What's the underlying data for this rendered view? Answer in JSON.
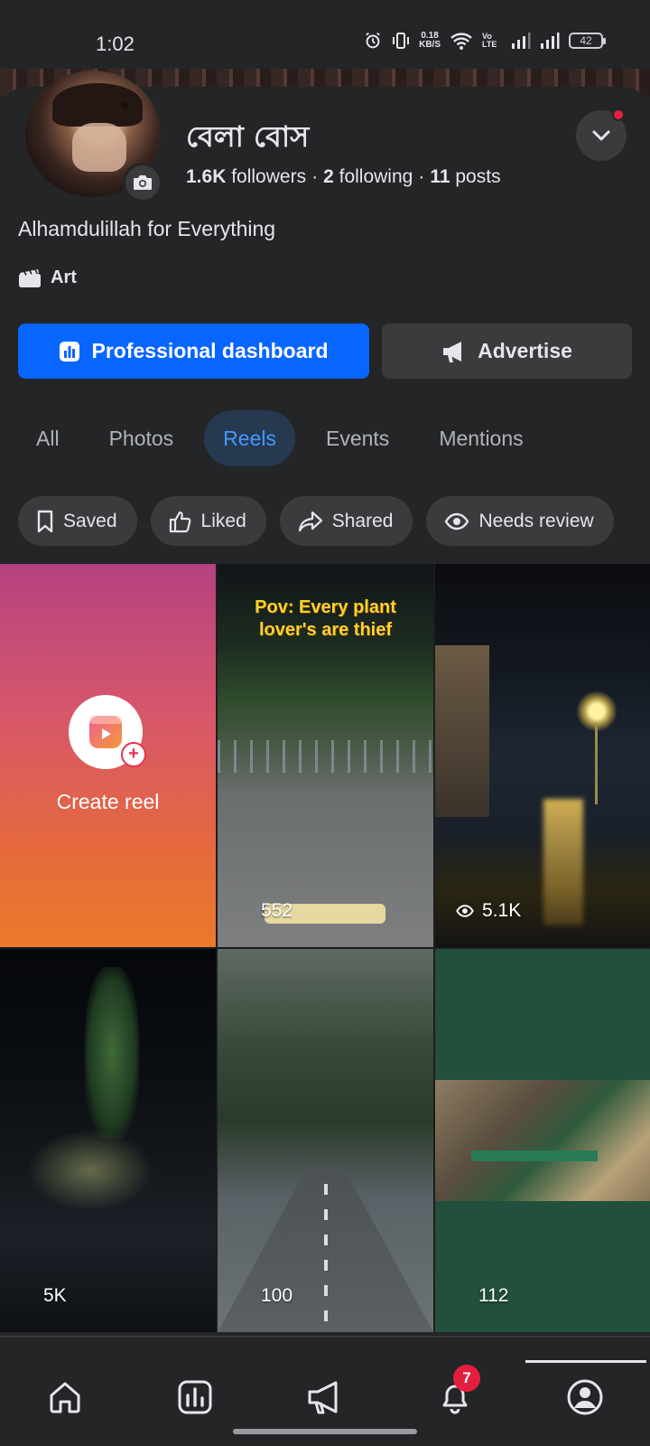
{
  "status_bar": {
    "time": "1:02",
    "speed_value": "0.18",
    "speed_unit": "KB/S",
    "volte": "Vo LTE",
    "battery": "42"
  },
  "profile": {
    "name": "বেলা বোস",
    "followers_count": "1.6K",
    "followers_label": "followers",
    "following_count": "2",
    "following_label": "following",
    "posts_count": "11",
    "posts_label": "posts",
    "separator": "·",
    "bio": "Alhamdulillah for Everything",
    "category": "Art"
  },
  "actions": {
    "professional_dashboard": "Professional dashboard",
    "advertise": "Advertise"
  },
  "tabs": [
    {
      "label": "All",
      "active": false
    },
    {
      "label": "Photos",
      "active": false
    },
    {
      "label": "Reels",
      "active": true
    },
    {
      "label": "Events",
      "active": false
    },
    {
      "label": "Mentions",
      "active": false
    }
  ],
  "filters": {
    "saved": "Saved",
    "liked": "Liked",
    "shared": "Shared",
    "needs_review": "Needs review"
  },
  "grid": {
    "create_label": "Create reel",
    "reels": [
      {
        "caption": "Pov: Every plant lover's are thief",
        "count": "552"
      },
      {
        "count": "5.1K",
        "icon": "eye-icon"
      },
      {
        "count": "5K"
      },
      {
        "count": "100"
      },
      {
        "count": "112"
      }
    ]
  },
  "nav": {
    "notifications_badge": "7",
    "active_item": "profile"
  },
  "colors": {
    "accent": "#0866ff",
    "background": "#242526",
    "chip": "#3a3b3c",
    "active_tab_bg": "#263951",
    "active_tab_text": "#4599ff",
    "badge": "#e41e3f"
  }
}
